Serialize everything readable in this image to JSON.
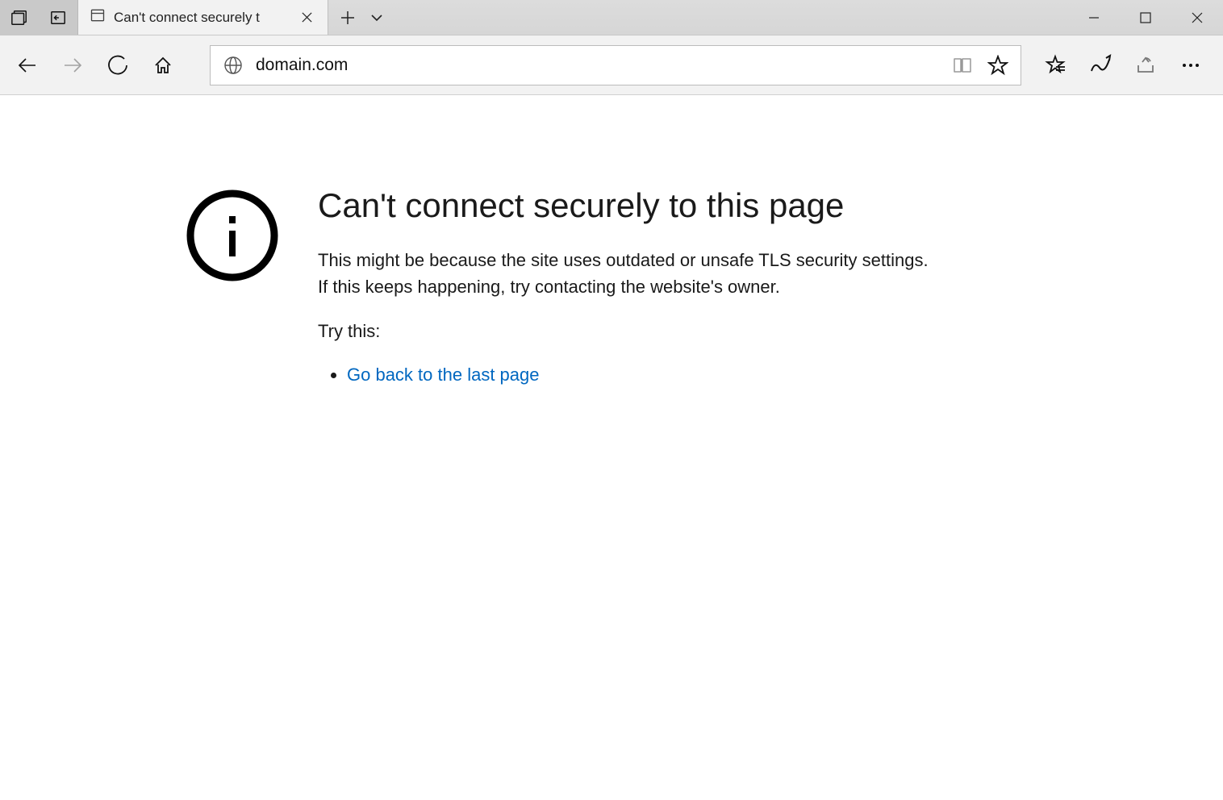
{
  "tab": {
    "title": "Can't connect securely t"
  },
  "address": {
    "url": "domain.com"
  },
  "error": {
    "title": "Can't connect securely to this page",
    "description": "This might be because the site uses outdated or unsafe TLS security settings. If this keeps happening, try contacting the website's owner.",
    "try_label": "Try this:",
    "suggestion_link": "Go back to the last page"
  }
}
